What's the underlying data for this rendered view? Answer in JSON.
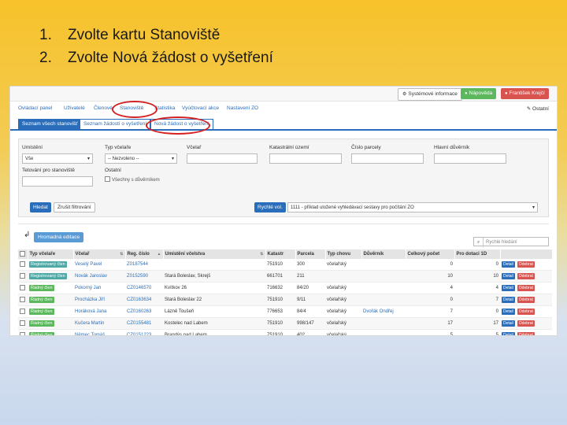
{
  "slide": {
    "steps": [
      {
        "number": "1.",
        "text": "Zvolte kartu Stanoviště"
      },
      {
        "number": "2.",
        "text": "Zvolte Nová žádost o vyšetření"
      }
    ]
  },
  "topbar": {
    "system_info": "Systémové informace",
    "help": "Nápověda",
    "user": "František Krejčí"
  },
  "nav": {
    "items": [
      "Ovládací panel",
      "Uživatelé",
      "Členové",
      "Stanoviště",
      "Statistika",
      "Vyúčtovací akce",
      "Nastavení ZO"
    ],
    "right": "Ostatní"
  },
  "subtabs": [
    "Seznam všech stanovišť",
    "Seznam žádostí o vyšetření",
    "Nová žádost o vyšetření"
  ],
  "filter": {
    "umisteni_label": "Umístění",
    "umisteni_value": "Vše",
    "typ_label": "Typ včelaře",
    "typ_value": "-- Nezvoleno --",
    "vcelar_label": "Včelař",
    "katastr_label": "Katastrální území",
    "parcela_label": "Číslo parcely",
    "duvernik_label": "Hlavní důvěrník",
    "tetovani_label": "Tetování pro stanoviště",
    "ostatni_label": "Ostatní",
    "vsechny_label": "Všechny s důvěrníkem",
    "search_button": "Hledat",
    "reset_button": "Zrušit filtrování",
    "presets_button": "Rychlé vol.",
    "preset_value": "1111 - příklad uložené vyhledávací sestavy pro počítání ZO"
  },
  "mass_action": "Hromadná editace",
  "search_placeholder": "Rychlé hledání",
  "table": {
    "headers": [
      "Typ včelaře",
      "Včelař",
      "Reg. číslo",
      "Umístění včelstva",
      "Katastr",
      "Parcela",
      "Typ chovu",
      "Důvěrník",
      "Celkový počet",
      "Pro dotaci 1D"
    ],
    "actions": {
      "detail": "Detail",
      "remove": "Odebrat"
    },
    "rows": [
      {
        "typ": "Registrovaný člen",
        "vcelar": "Veselý Pavel",
        "reg": "Z0187544",
        "umisteni": "",
        "katastr": "751910",
        "parcela": "300",
        "chov": "včelařský",
        "duvernik": "",
        "celkem": "0",
        "dotace": "0"
      },
      {
        "typ": "Registrovaný člen",
        "vcelar": "Novák Jaroslav",
        "reg": "Z0152590",
        "umisteni": "Stará Boleslav, Skrejš",
        "katastr": "661701",
        "parcela": "211",
        "chov": "",
        "duvernik": "",
        "celkem": "10",
        "dotace": "10"
      },
      {
        "typ": "Řádný člen",
        "vcelar": "Pokorný Jan",
        "reg": "CZ0146570",
        "umisteni": "Kvítkov 26",
        "katastr": "716632",
        "parcela": "84/20",
        "chov": "včelařský",
        "duvernik": "",
        "celkem": "4",
        "dotace": "4"
      },
      {
        "typ": "Řádný člen",
        "vcelar": "Procházka Jiří",
        "reg": "CZ0163634",
        "umisteni": "Stará Boleslav 22",
        "katastr": "751910",
        "parcela": "9/11",
        "chov": "včelařský",
        "duvernik": "",
        "celkem": "0",
        "dotace": "7"
      },
      {
        "typ": "Řádný člen",
        "vcelar": "Horáková Jana",
        "reg": "CZ0160263",
        "umisteni": "Lázně Toušeň",
        "katastr": "776653",
        "parcela": "84/4",
        "chov": "včelařský",
        "duvernik": "Dvořák Ondřej",
        "celkem": "7",
        "dotace": "0"
      },
      {
        "typ": "Řádný člen",
        "vcelar": "Kučera Martin",
        "reg": "CZ0155481",
        "umisteni": "Kostelec nad Labem",
        "katastr": "751910",
        "parcela": "998/147",
        "chov": "včelařský",
        "duvernik": "",
        "celkem": "17",
        "dotace": "17"
      },
      {
        "typ": "Řádný člen",
        "vcelar": "Němec Tomáš",
        "reg": "CZ0151223",
        "umisteni": "Brandýs nad Labem",
        "katastr": "751910",
        "parcela": "402",
        "chov": "včelařský",
        "duvernik": "",
        "celkem": "5",
        "dotace": "5"
      }
    ]
  }
}
